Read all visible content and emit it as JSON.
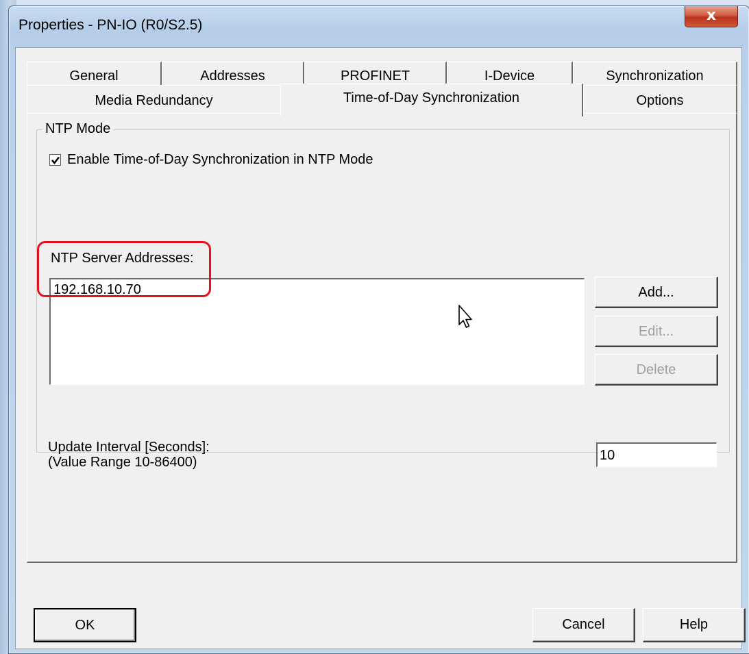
{
  "window": {
    "title": "Properties - PN-IO (R0/S2.5)",
    "close_glyph": "x"
  },
  "tabs": {
    "row1": [
      {
        "label": "General"
      },
      {
        "label": "Addresses"
      },
      {
        "label": "PROFINET"
      },
      {
        "label": "I-Device"
      },
      {
        "label": "Synchronization"
      }
    ],
    "row2": [
      {
        "label": "Media Redundancy"
      },
      {
        "label": "Time-of-Day Synchronization",
        "active": true
      },
      {
        "label": "Options"
      }
    ]
  },
  "ntp": {
    "group_label": "NTP Mode",
    "enable_label": "Enable Time-of-Day Synchronization in NTP Mode",
    "enable_checked": true,
    "servers_label": "NTP Server Addresses:",
    "servers": [
      "192.168.10.70"
    ],
    "add_label": "Add...",
    "edit_label": "Edit...",
    "delete_label": "Delete",
    "interval_label_line1": "Update Interval [Seconds]:",
    "interval_label_line2": "(Value Range 10-86400)",
    "interval_value": "10"
  },
  "footer": {
    "ok_label": "OK",
    "cancel_label": "Cancel",
    "help_label": "Help"
  },
  "colors": {
    "highlight": "#e3121f",
    "close_button": "#c94a2f"
  },
  "icons": {
    "cursor": "mouse-pointer-icon",
    "check": "checkmark-icon"
  }
}
